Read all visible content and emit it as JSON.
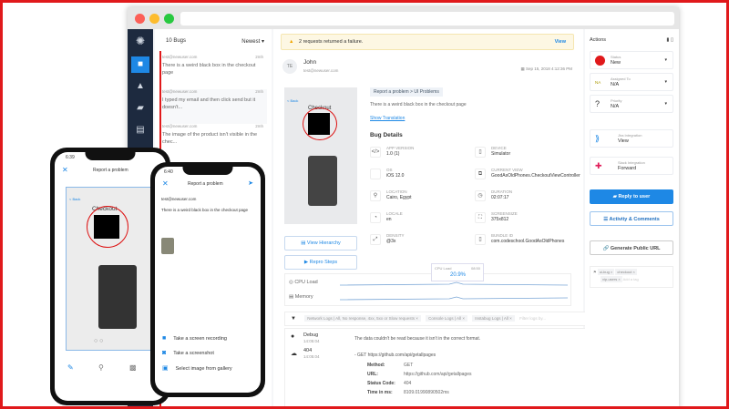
{
  "bug_list": {
    "count_label": "10 Bugs",
    "sort": "Newest",
    "items": [
      {
        "email": "test@newuser.com",
        "time": "2mh",
        "text": "There is a weird black box in the checkout page"
      },
      {
        "email": "test@newuser.com",
        "time": "2mh",
        "text": "I typed my email and then click send but it doesn't..."
      },
      {
        "email": "test@newuser.com",
        "time": "2mh",
        "text": "The image of the product isn't visible in the chec..."
      }
    ]
  },
  "banner": {
    "text": "2 requests returned a failure.",
    "link": "View"
  },
  "reporter": {
    "initials": "TE",
    "name": "John",
    "email": "test@newuser.com",
    "date": "Sep 15, 2018 4:12:36 PM"
  },
  "report": {
    "category": "Report a problem > UI Problems",
    "message": "There is a weird black box in the checkout page",
    "translate": "Show Translation",
    "details_title": "Bug Details",
    "thumb_title": "Checkout",
    "thumb_back": "< Back",
    "details": [
      {
        "label": "APP VERSION",
        "value": "1.0 (1)",
        "icon": "</>"
      },
      {
        "label": "DEVICE",
        "value": "Simulator",
        "icon": "▯"
      },
      {
        "label": "OS",
        "value": "iOS 12.0",
        "icon": ""
      },
      {
        "label": "CURRENT VIEW",
        "value": "GoodAsOldPhones.CheckoutViewController",
        "icon": "⧉"
      },
      {
        "label": "LOCATION",
        "value": "Cairo, Egypt",
        "icon": "⚲"
      },
      {
        "label": "DURATION",
        "value": "02:07:17",
        "icon": "◷"
      },
      {
        "label": "LOCALE",
        "value": "en",
        "icon": "◔"
      },
      {
        "label": "SCREENSIZE",
        "value": "375x812",
        "icon": "⛶"
      },
      {
        "label": "DENSITY",
        "value": "@3x",
        "icon": "⤢"
      },
      {
        "label": "BUNDLE ID",
        "value": "com.codeschool.GoodAsOldPhones",
        "icon": "▯"
      }
    ]
  },
  "buttons": {
    "view_hierarchy": "View Hierarchy",
    "repro_steps": "Repro Steps"
  },
  "metrics": {
    "cpu_label": "CPU Load",
    "memory_label": "Memory",
    "tooltip_label": "CPU Load",
    "tooltip_time": "08:50",
    "tooltip_value": "20.9%"
  },
  "logs": {
    "filters": [
      "Network Logs | All, No response, 4xx, 5xx or Slow requests",
      "Console Logs | All",
      "Instabug Logs | All"
    ],
    "filter_placeholder": "Filter logs by...",
    "entries": [
      {
        "type": "Debug",
        "time": "14:05:04",
        "text": "The data couldn't be read because it isn't in the correct format."
      },
      {
        "type": "404",
        "time": "14:05:04",
        "text": "- GET https://github.com/api/getallpages"
      }
    ],
    "fields": [
      {
        "k": "Method:",
        "v": "GET"
      },
      {
        "k": "URL:",
        "v": "https://github.com/api/getallpages"
      },
      {
        "k": "Status Code:",
        "v": "404"
      },
      {
        "k": "Time in ms:",
        "v": "8109.01990890502ms"
      }
    ]
  },
  "actions": {
    "title": "Actions",
    "status": {
      "label": "Status",
      "value": "New"
    },
    "assigned": {
      "label": "Assigned To",
      "value": "N/A",
      "initials": "NA"
    },
    "priority": {
      "label": "Priority",
      "value": "N/A"
    },
    "jira": {
      "label": "Jira Integration",
      "value": "View"
    },
    "slack": {
      "label": "Slack Integration",
      "value": "Forward"
    },
    "reply": "Reply to user",
    "activity": "Activity & Comments",
    "public_url": "Generate Public URL",
    "tags": [
      "ui-bug",
      "checkout",
      "vip-users"
    ],
    "tag_placeholder": "Add a tag"
  },
  "phone1": {
    "time": "6:39",
    "title": "Report a problem",
    "checkout": "Checkout",
    "back": "< Back"
  },
  "phone2": {
    "time": "6:40",
    "title": "Report a problem",
    "email": "test@newuser.com",
    "message": "There is a weird black box in the checkout page",
    "options": [
      "Take a screen recording",
      "Take a screenshot",
      "Select image from gallery"
    ]
  },
  "colors": {
    "accent": "#1e88e5",
    "sidebar": "#1d2a3f",
    "status_red": "#e0191b",
    "frame": "#e0191b"
  }
}
